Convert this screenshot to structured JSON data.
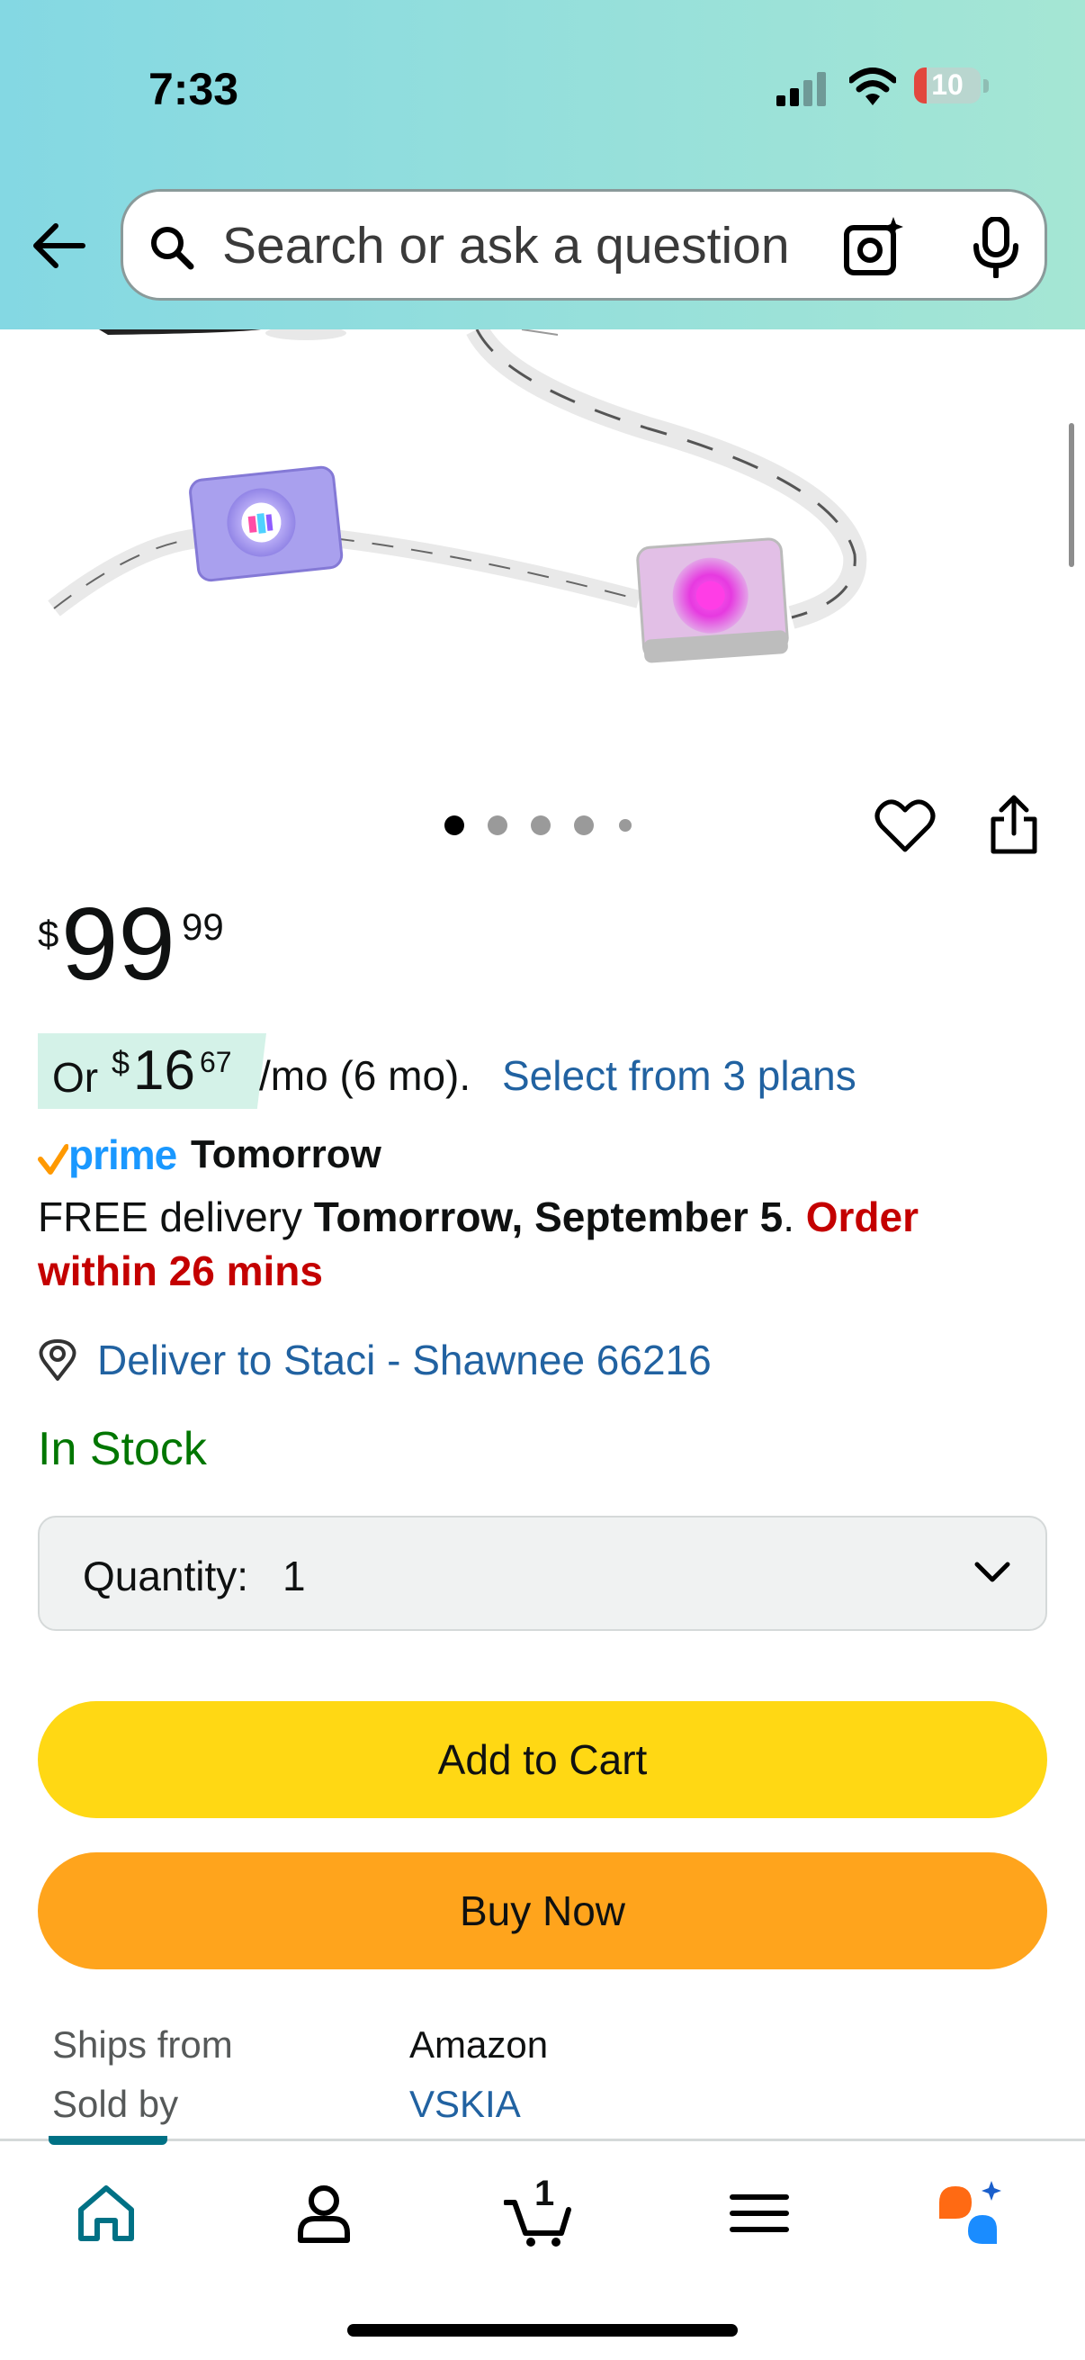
{
  "status_bar": {
    "time": "7:33",
    "battery": "10"
  },
  "search": {
    "placeholder": "Search or ask a question"
  },
  "product": {
    "image_dots": 5,
    "price": {
      "currency": "$",
      "whole": "99",
      "fraction": "99"
    },
    "monthly": {
      "prefix": "Or",
      "currency": "$",
      "amount": "16",
      "cents": "67",
      "period": "/mo (6 mo).",
      "plans_link": "Select from 3 plans"
    },
    "prime": {
      "word": "prime",
      "day": "Tomorrow"
    },
    "delivery": {
      "free": "FREE delivery ",
      "date": "Tomorrow, September 5",
      "period": ". ",
      "order_within": "Order within 26 mins"
    },
    "deliver_to": "Deliver to Staci - Shawnee 66216",
    "stock": "In Stock",
    "quantity": {
      "label": "Quantity:",
      "value": "1"
    },
    "add_to_cart": "Add to Cart",
    "buy_now": "Buy Now",
    "ships_from": {
      "label": "Ships from",
      "value": "Amazon"
    },
    "sold_by": {
      "label": "Sold by",
      "value": "VSKIA"
    }
  },
  "tabbar": {
    "cart_count": "1",
    "items": [
      "home-icon",
      "account-icon",
      "cart-icon",
      "menu-icon",
      "rufus-icon"
    ]
  },
  "colors": {
    "header_gradient_start": "#84d8e3",
    "header_gradient_end": "#a5e6d4",
    "link": "#2162a1",
    "in_stock": "#007600",
    "urgent": "#c40000",
    "add_to_cart": "#ffd814",
    "buy_now": "#ffa41c",
    "active_tab": "#007185",
    "prime": "#1a98ff"
  }
}
